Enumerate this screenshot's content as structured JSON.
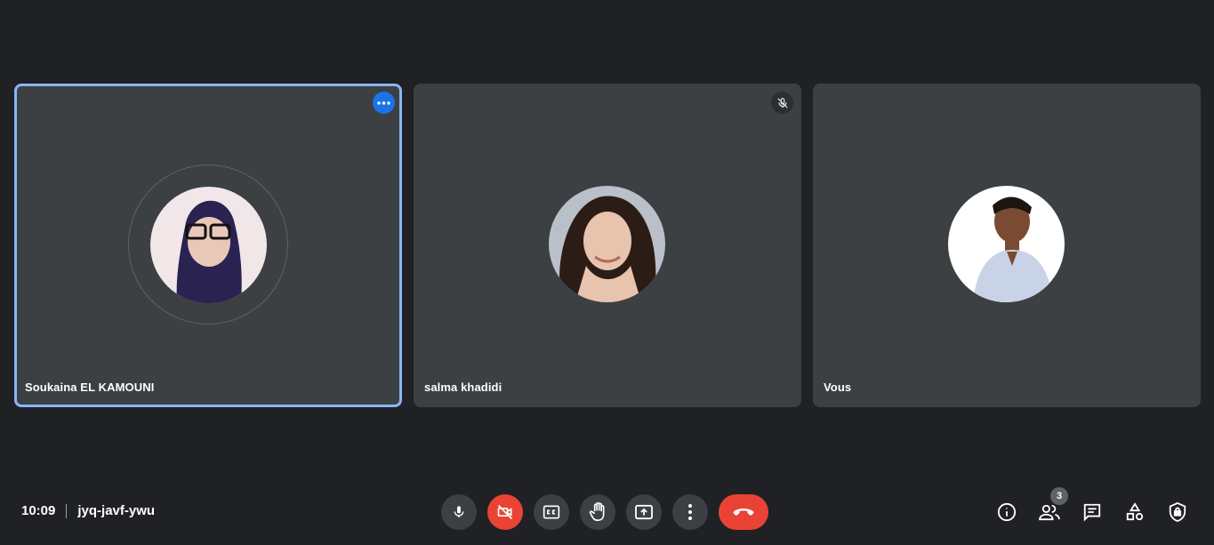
{
  "participants": [
    {
      "name": "Soukaina EL KAMOUNI",
      "active_speaker": true
    },
    {
      "name": "salma khadidi",
      "muted": true
    },
    {
      "name": "Vous"
    }
  ],
  "meeting": {
    "time": "10:09",
    "code": "jyq-javf-ywu"
  },
  "participants_count": "3",
  "colors": {
    "background": "#202124",
    "tile": "#3c4043",
    "highlight": "#8ab4f8",
    "danger": "#ea4335",
    "accent": "#1a73e8"
  },
  "controls": [
    "microphone-icon",
    "camera-off-icon",
    "captions-icon",
    "raise-hand-icon",
    "present-screen-icon",
    "more-options-icon",
    "hang-up-icon"
  ],
  "side_controls": [
    "info-icon",
    "people-icon",
    "chat-icon",
    "activities-icon",
    "host-controls-icon"
  ]
}
